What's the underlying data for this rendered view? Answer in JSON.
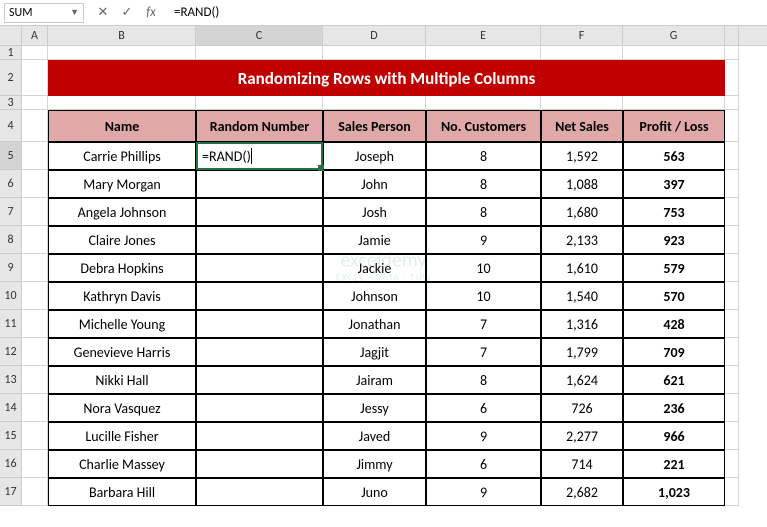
{
  "formula_bar": {
    "name_box": "SUM",
    "cancel_icon": "✕",
    "confirm_icon": "✓",
    "fx_icon": "fx",
    "formula": "=RAND()"
  },
  "columns": [
    "",
    "A",
    "B",
    "C",
    "D",
    "E",
    "F",
    "G",
    ""
  ],
  "active_col": "C",
  "active_row": "5",
  "title_banner": "Randomizing Rows with Multiple Columns",
  "headers": {
    "b": "Name",
    "c": "Random Number",
    "d": "Sales Person",
    "e": "No. Customers",
    "f": "Net Sales",
    "g": "Profit / Loss"
  },
  "editing_value": "=RAND()",
  "rows": [
    {
      "n": "5",
      "name": "Carrie Phillips",
      "rand": "",
      "sp": "Joseph",
      "nc": "8",
      "ns": "1,592",
      "pl": "563"
    },
    {
      "n": "6",
      "name": "Mary Morgan",
      "rand": "",
      "sp": "John",
      "nc": "8",
      "ns": "1,088",
      "pl": "397"
    },
    {
      "n": "7",
      "name": "Angela Johnson",
      "rand": "",
      "sp": "Josh",
      "nc": "8",
      "ns": "1,680",
      "pl": "753"
    },
    {
      "n": "8",
      "name": "Claire Jones",
      "rand": "",
      "sp": "Jamie",
      "nc": "9",
      "ns": "2,133",
      "pl": "923"
    },
    {
      "n": "9",
      "name": "Debra Hopkins",
      "rand": "",
      "sp": "Jackie",
      "nc": "10",
      "ns": "1,610",
      "pl": "579"
    },
    {
      "n": "10",
      "name": "Kathryn Davis",
      "rand": "",
      "sp": "Johnson",
      "nc": "10",
      "ns": "1,540",
      "pl": "570"
    },
    {
      "n": "11",
      "name": "Michelle Young",
      "rand": "",
      "sp": "Jonathan",
      "nc": "7",
      "ns": "1,316",
      "pl": "428"
    },
    {
      "n": "12",
      "name": "Genevieve Harris",
      "rand": "",
      "sp": "Jagjit",
      "nc": "7",
      "ns": "1,799",
      "pl": "709"
    },
    {
      "n": "13",
      "name": "Nikki Hall",
      "rand": "",
      "sp": "Jairam",
      "nc": "8",
      "ns": "1,624",
      "pl": "621"
    },
    {
      "n": "14",
      "name": "Nora Vasquez",
      "rand": "",
      "sp": "Jessy",
      "nc": "6",
      "ns": "726",
      "pl": "236"
    },
    {
      "n": "15",
      "name": "Lucille Fisher",
      "rand": "",
      "sp": "Javed",
      "nc": "9",
      "ns": "2,277",
      "pl": "966"
    },
    {
      "n": "16",
      "name": "Charlie Massey",
      "rand": "",
      "sp": "Jimmy",
      "nc": "6",
      "ns": "714",
      "pl": "221"
    },
    {
      "n": "17",
      "name": "Barbara Hill",
      "rand": "",
      "sp": "Juno",
      "nc": "9",
      "ns": "2,682",
      "pl": "1,023"
    }
  ],
  "watermark": {
    "main": "exceldemy",
    "sub": "EXCEL · DATA · TIPS"
  }
}
